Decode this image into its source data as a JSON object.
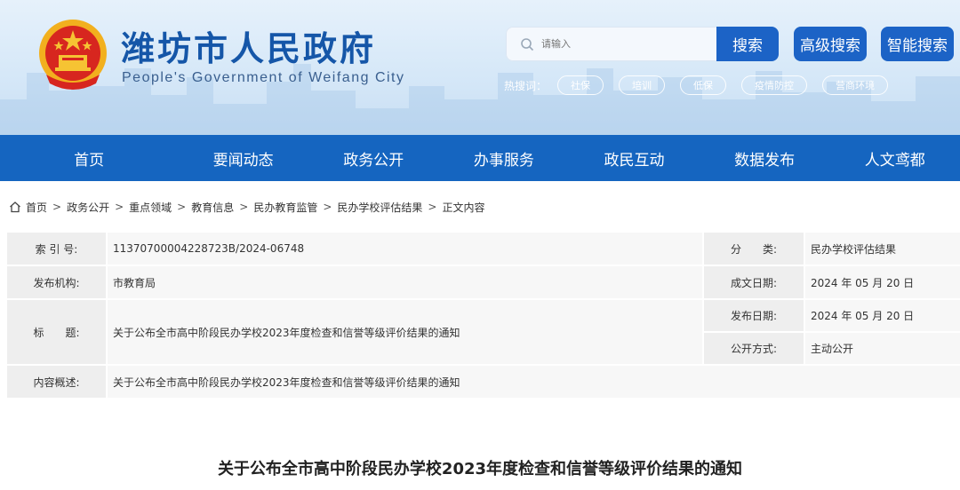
{
  "header": {
    "title": "潍坊市人民政府",
    "subtitle": "People's Government of Weifang City",
    "search_placeholder": "请输入",
    "search_button": "搜索",
    "advanced_search_button": "高级搜索",
    "smart_search_button": "智能搜索",
    "hotwords_label": "热搜词：",
    "hotwords": [
      "社保",
      "培训",
      "低保",
      "疫情防控",
      "营商环境"
    ]
  },
  "nav": {
    "items": [
      "首页",
      "要闻动态",
      "政务公开",
      "办事服务",
      "政民互动",
      "数据发布",
      "人文鸢都"
    ]
  },
  "breadcrumb": {
    "items": [
      "首页",
      "政务公开",
      "重点领域",
      "教育信息",
      "民办教育监管",
      "民办学校评估结果",
      "正文内容"
    ],
    "separator": ">"
  },
  "info": {
    "index_label": "索 引 号:",
    "index_value": "11370700004228723B/2024-06748",
    "category_label": "分　　类:",
    "category_value": "民办学校评估结果",
    "publisher_label": "发布机构:",
    "publisher_value": "市教育局",
    "created_label": "成文日期:",
    "created_value": "2024 年 05 月 20 日",
    "title_label": "标　　题:",
    "title_value": "关于公布全市高中阶段民办学校2023年度检查和信誉等级评价结果的通知",
    "published_label": "发布日期:",
    "published_value": "2024 年 05 月 20 日",
    "disclosure_label": "公开方式:",
    "disclosure_value": "主动公开",
    "summary_label": "内容概述:",
    "summary_value": "关于公布全市高中阶段民办学校2023年度检查和信誉等级评价结果的通知"
  },
  "article": {
    "title": "关于公布全市高中阶段民办学校2023年度检查和信誉等级评价结果的通知"
  },
  "colors": {
    "brand_blue": "#1565c0",
    "button_blue": "#1c63c6",
    "title_blue": "#1556a8"
  }
}
